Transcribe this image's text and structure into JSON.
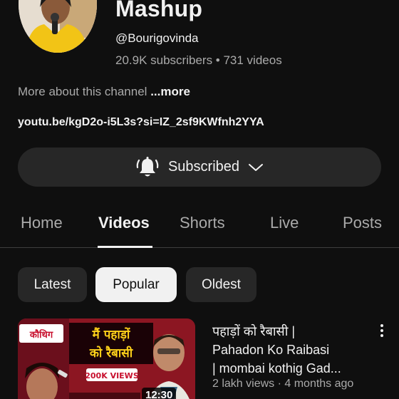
{
  "channel": {
    "title": "Mashup",
    "handle": "@Bourigovinda",
    "stats": "20.9K subscribers • 731 videos",
    "about_text": "More about this channel",
    "about_more": "...more",
    "link": "youtu.be/kgD2o-i5L3s?si=IZ_2sf9KWfnh2YYA"
  },
  "subscribe": {
    "label": "Subscribed",
    "bell_icon": "bell-ring-icon",
    "chevron_icon": "chevron-down-icon"
  },
  "tabs": [
    {
      "label": "Home"
    },
    {
      "label": "Videos",
      "active": true
    },
    {
      "label": "Shorts"
    },
    {
      "label": "Live"
    },
    {
      "label": "Posts"
    }
  ],
  "chips": [
    {
      "label": "Latest"
    },
    {
      "label": "Popular",
      "selected": true
    },
    {
      "label": "Oldest"
    }
  ],
  "video": {
    "title_lines": [
      "पहाड़ों को रैबासी |",
      "Pahadon Ko Raibasi",
      "| mombai kothig Gad..."
    ],
    "meta": "2 lakh views · 4 months ago",
    "duration": "12:30",
    "thumb_text_1": "मैं पहाड़ों",
    "thumb_text_2": "को रैबासी",
    "thumb_badge": "200K VIEWS",
    "thumb_logo": "कौथिग"
  },
  "colors": {
    "background": "#0f0f0f",
    "surface": "#272727",
    "text_primary": "#f1f1f1",
    "text_secondary": "#aaaaaa"
  }
}
